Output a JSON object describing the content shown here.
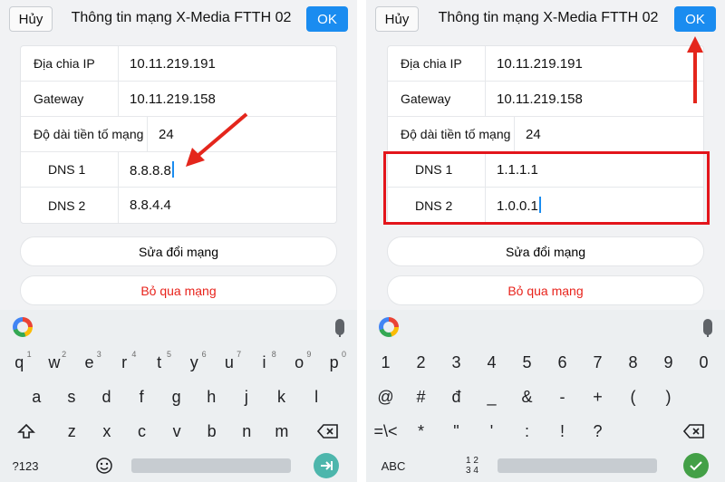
{
  "left": {
    "cancel": "Hủy",
    "title": "Thông tin mạng X-Media FTTH 02",
    "ok": "OK",
    "rows": [
      {
        "label": "Địa chia IP",
        "value": "10.11.219.191"
      },
      {
        "label": "Gateway",
        "value": "10.11.219.158"
      },
      {
        "label": "Độ dài tiền tố mạng",
        "value": "24"
      },
      {
        "label": "DNS 1",
        "value": "8.8.8.8"
      },
      {
        "label": "DNS 2",
        "value": "8.8.4.4"
      }
    ],
    "modify": "Sửa đổi mạng",
    "forget": "Bỏ qua mạng",
    "keyboard": {
      "row1": [
        "q",
        "w",
        "e",
        "r",
        "t",
        "y",
        "u",
        "i",
        "o",
        "p"
      ],
      "row1_hints": [
        "1",
        "2",
        "3",
        "4",
        "5",
        "6",
        "7",
        "8",
        "9",
        "0"
      ],
      "row2": [
        "a",
        "s",
        "d",
        "f",
        "g",
        "h",
        "j",
        "k",
        "l"
      ],
      "row3": [
        "z",
        "x",
        "c",
        "v",
        "b",
        "n",
        "m"
      ],
      "symbols_key": "?123"
    }
  },
  "right": {
    "cancel": "Hủy",
    "title": "Thông tin mạng X-Media FTTH 02",
    "ok": "OK",
    "rows": [
      {
        "label": "Địa chia IP",
        "value": "10.11.219.191"
      },
      {
        "label": "Gateway",
        "value": "10.11.219.158"
      },
      {
        "label": "Độ dài tiền tố mạng",
        "value": "24"
      },
      {
        "label": "DNS 1",
        "value": "1.1.1.1"
      },
      {
        "label": "DNS 2",
        "value": "1.0.0.1"
      }
    ],
    "modify": "Sửa đổi mạng",
    "forget": "Bỏ qua mạng",
    "keyboard": {
      "row1": [
        "1",
        "2",
        "3",
        "4",
        "5",
        "6",
        "7",
        "8",
        "9",
        "0"
      ],
      "row2": [
        "@",
        "#",
        "đ",
        "_",
        "&",
        "-",
        "+",
        "(",
        ")"
      ],
      "row3": [
        "=\\<",
        "*",
        "\"",
        "'",
        ":",
        "!",
        "?"
      ],
      "abc_key": "ABC",
      "fraction_key_top": "1 2",
      "fraction_key_bottom": "3 4"
    }
  },
  "colors": {
    "accent": "#1a8cf0",
    "danger": "#e8231c",
    "annotation": "#e4261c",
    "enter_left": "#4db6ac",
    "enter_right": "#43a047"
  },
  "icons": [
    "google-icon",
    "mic-icon",
    "shift-icon",
    "backspace-icon",
    "emoji-icon",
    "enter-icon",
    "check-icon"
  ]
}
